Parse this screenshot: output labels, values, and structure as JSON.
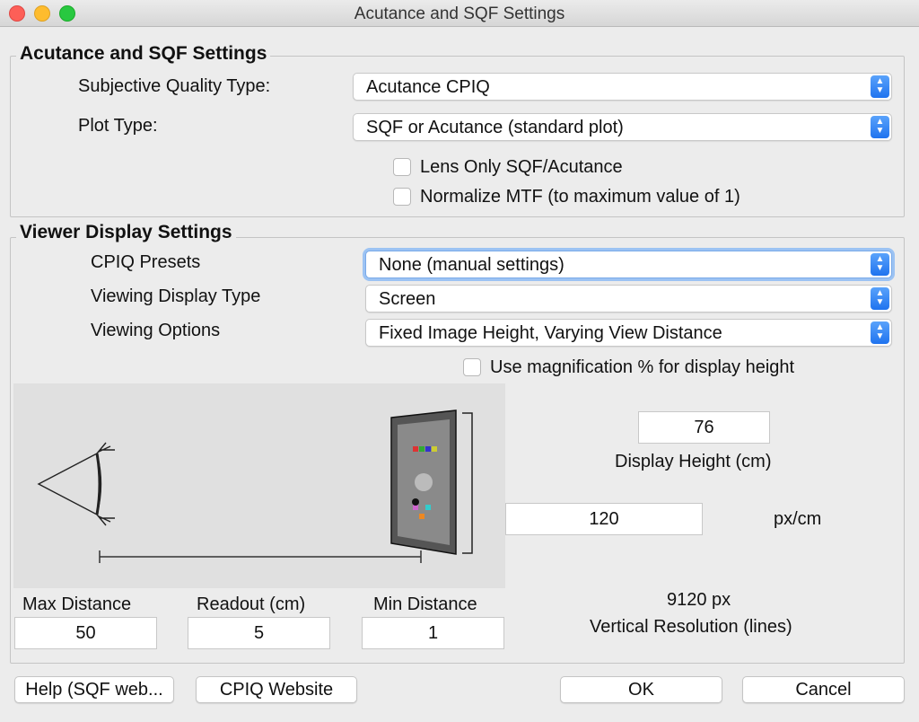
{
  "window": {
    "title": "Acutance and SQF Settings"
  },
  "acutance_group": {
    "legend": "Acutance and SQF Settings",
    "subjective_quality_label": "Subjective Quality Type:",
    "subjective_quality_value": "Acutance CPIQ",
    "plot_type_label": "Plot Type:",
    "plot_type_value": "SQF or Acutance (standard plot)",
    "lens_only_label": "Lens Only SQF/Acutance",
    "lens_only_checked": false,
    "normalize_label": "Normalize MTF (to maximum value of 1)",
    "normalize_checked": false
  },
  "viewer_group": {
    "legend": "Viewer Display Settings",
    "cpiq_presets_label": "CPIQ Presets",
    "cpiq_presets_value": "None (manual settings)",
    "display_type_label": "Viewing Display Type",
    "display_type_value": "Screen",
    "options_label": "Viewing Options",
    "options_value": "Fixed Image Height, Varying View Distance",
    "magnification_label": "Use magnification % for display height",
    "magnification_checked": false,
    "display_height_value": "76",
    "display_height_label": "Display Height (cm)",
    "px_per_cm_value": "120",
    "px_per_cm_unit": "px/cm",
    "vertical_resolution_value": "9120 px",
    "vertical_resolution_label": "Vertical Resolution (lines)",
    "max_distance_label": "Max Distance",
    "max_distance_value": "50",
    "readout_label": "Readout (cm)",
    "readout_value": "5",
    "min_distance_label": "Min Distance",
    "min_distance_value": "1"
  },
  "buttons": {
    "help": "Help (SQF web...",
    "cpiq_website": "CPIQ Website",
    "ok": "OK",
    "cancel": "Cancel"
  }
}
